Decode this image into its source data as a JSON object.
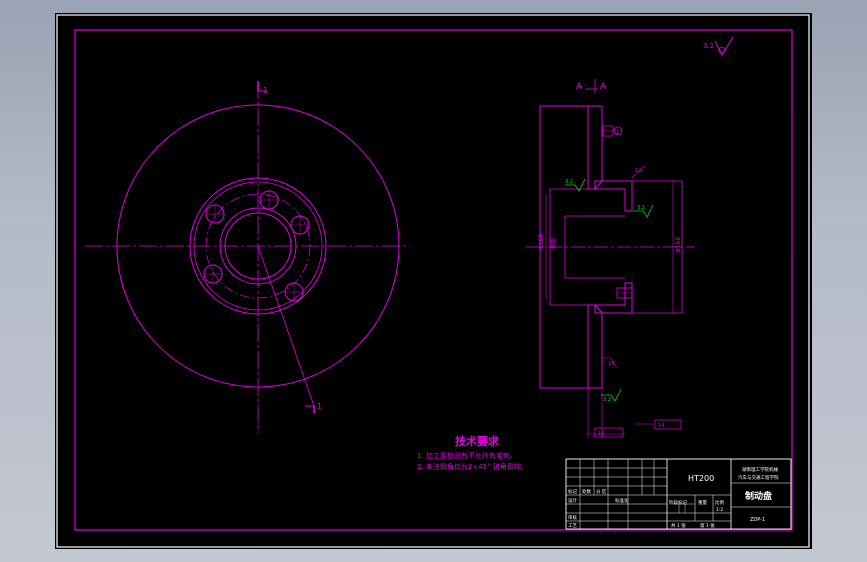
{
  "tech_requirements": {
    "title": "技术要求",
    "line1": "1. 加工后检测有不允许有毛刺。",
    "line2": "2. 未注倒角均为2×45°  锐角倒钝。"
  },
  "title_block": {
    "material": "HT200",
    "school_line1": "湖南理工学院机械",
    "school_line2": "汽车与交通工程学院",
    "part_name": "制动盘",
    "drawing_no": "ZDP-1",
    "scale": "1:2",
    "sheet_total": "共 1 张",
    "sheet_no": "第 1 张",
    "labels": {
      "mark": "标记",
      "count": "处数",
      "zone": "分 区",
      "design": "设计",
      "check": "审核",
      "process": "工艺",
      "standard": "标准化",
      "stage": "阶段标记",
      "weight": "重量",
      "ratio": "比例"
    }
  },
  "annotations": {
    "section_mark": "A",
    "section_mark_end": "A",
    "tag_1": "1",
    "roughness_main": "3.2",
    "roughness_green_1": "3.2",
    "roughness_green_2": "3.2",
    "roughness_green_3": "3.2"
  },
  "dimensions": {
    "d_outer": "Φ280",
    "d_hub_small": "Φ85",
    "d_hub_bore": "Φ168",
    "d_right": "Φ168",
    "t_label": "16",
    "w_label": "14",
    "thickness": "12"
  },
  "colors": {
    "line": "#e000e0",
    "text": "#ffffff",
    "roughness": "#00e000",
    "background": "#000000"
  }
}
